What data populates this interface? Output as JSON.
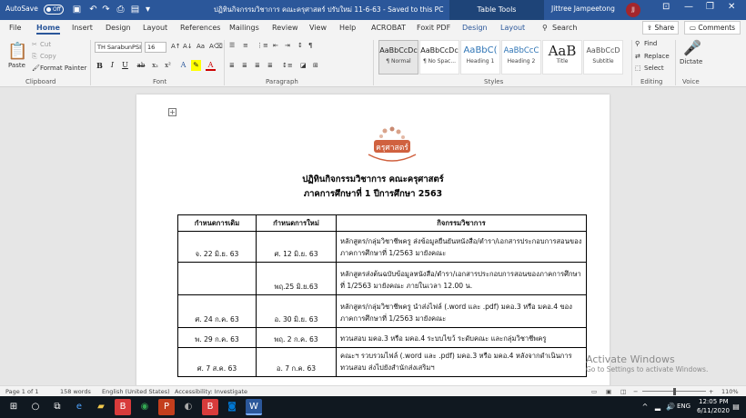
{
  "titlebar": {
    "autosave_label": "AutoSave",
    "autosave_state": "Off",
    "doc_title": "ปฏิทินกิจกรรมวิชาการ คณะครุศาสตร์ ปรับใหม่ 11-6-63 - Saved to this PC",
    "context_tab": "Table Tools",
    "user_name": "Jittree Jampeetong",
    "user_initials": "JJ",
    "win_controls": [
      "—",
      "❐",
      "✕"
    ]
  },
  "tabs": {
    "items": [
      "File",
      "Home",
      "Insert",
      "Design",
      "Layout",
      "References",
      "Mailings",
      "Review",
      "View",
      "Help",
      "ACROBAT",
      "Foxit PDF",
      "Design",
      "Layout"
    ],
    "search_label": "Search",
    "share_label": "Share",
    "comments_label": "Comments"
  },
  "ribbon": {
    "clipboard": {
      "paste": "Paste",
      "cut": "Cut",
      "copy": "Copy",
      "format_painter": "Format Painter",
      "label": "Clipboard"
    },
    "font": {
      "name": "TH SarabunPSI",
      "size": "16",
      "label": "Font",
      "buttons": [
        "B",
        "I",
        "U",
        "ab",
        "x₂",
        "x²"
      ]
    },
    "paragraph": {
      "label": "Paragraph"
    },
    "styles": {
      "label": "Styles",
      "items": [
        {
          "preview": "AaBbCcDc",
          "name": "¶ Normal"
        },
        {
          "preview": "AaBbCcDc",
          "name": "¶ No Spac..."
        },
        {
          "preview": "AaBbC(",
          "name": "Heading 1"
        },
        {
          "preview": "AaBbCcC",
          "name": "Heading 2"
        },
        {
          "preview": "AaB",
          "name": "Title"
        },
        {
          "preview": "AaBbCcD",
          "name": "Subtitle"
        }
      ]
    },
    "editing": {
      "find": "Find",
      "replace": "Replace",
      "select": "Select",
      "label": "Editing"
    },
    "voice": {
      "dictate": "Dictate",
      "label": "Voice"
    }
  },
  "document": {
    "logo_text": "ครุศาสตร์",
    "title": "ปฏิทินกิจกรรมวิชาการ คณะครุศาสตร์",
    "subtitle": "ภาคการศึกษาที่ 1 ปีการศึกษา 2563",
    "table": {
      "headers": [
        "กำหนดการเดิม",
        "กำหนดการใหม่",
        "กิจกรรมวิชาการ"
      ],
      "rows": [
        {
          "old": "จ. 22 มิ.ย. 63",
          "new": "ศ. 12 มิ.ย. 63",
          "activity": "หลักสูตร/กลุ่มวิชาชีพครู ส่งข้อมูลยืนยันหนังสือ/ตำรา/เอกสารประกอบการสอนของภาคการศึกษาที่ 1/2563 มายังคณะ"
        },
        {
          "old": "",
          "new": "พฤ.25 มิ.ย.63",
          "activity": "หลักสูตรส่งต้นฉบับข้อมูลหนังสือ/ตำรา/เอกสารประกอบการสอนของภาคการศึกษาที่ 1/2563 มายังคณะ ภายในเวลา 12.00 น."
        },
        {
          "old": "ศ. 24 ก.ค. 63",
          "new": "อ. 30 มิ.ย. 63",
          "activity": "หลักสูตร/กลุ่มวิชาชีพครู นำส่งไฟล์ (.word และ .pdf) มคอ.3 หรือ มคอ.4 ของภาคการศึกษาที่ 1/2563 มายังคณะ"
        },
        {
          "old": "พ. 29 ก.ค. 63",
          "new": "พฤ. 2 ก.ค. 63",
          "activity": "ทวนสอบ มคอ.3 หรือ มคอ.4 ระบบไขว้ ระดับคณะ และกลุ่มวิชาชีพครู"
        },
        {
          "old": "ศ. 7 ส.ค. 63",
          "new": "อ. 7 ก.ค. 63",
          "activity": "คณะฯ รวบรวมไฟล์ (.word และ .pdf) มคอ.3 หรือ มคอ.4 หลังจากดำเนินการทวนสอบ ส่งไปยังสำนักส่งเสริมฯ"
        }
      ]
    }
  },
  "watermark": {
    "line1": "Activate Windows",
    "line2": "Go to Settings to activate Windows."
  },
  "statusbar": {
    "page": "Page 1 of 1",
    "words": "158 words",
    "language": "English (United States)",
    "accessibility": "Accessibility: Investigate",
    "zoom": "110%"
  },
  "taskbar": {
    "time": "12:05 PM",
    "date": "6/11/2020",
    "lang": "ENG"
  },
  "colors": {
    "word_blue": "#2b579a",
    "taskbar": "#101820"
  }
}
